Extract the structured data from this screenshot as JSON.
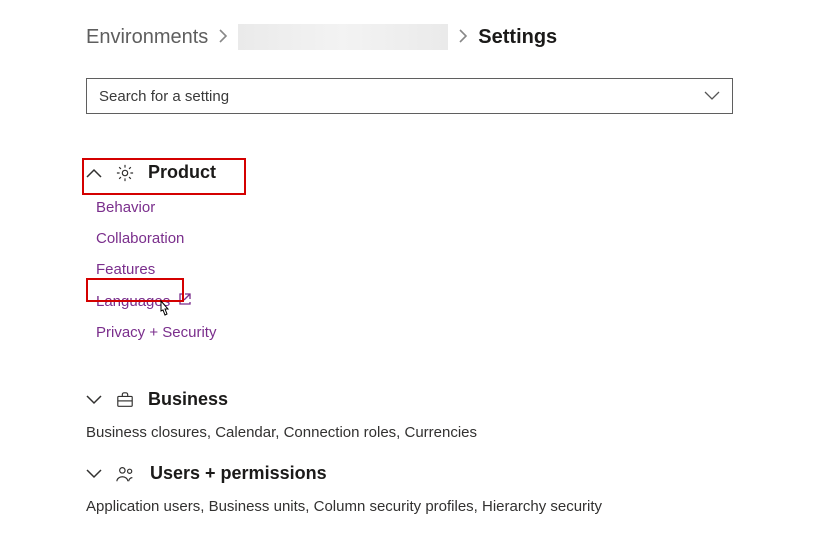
{
  "breadcrumb": {
    "root": "Environments",
    "current": "Settings"
  },
  "search": {
    "placeholder": "Search for a setting"
  },
  "sections": {
    "product": {
      "title": "Product",
      "links": {
        "behavior": "Behavior",
        "collaboration": "Collaboration",
        "features": "Features",
        "languages": "Languages",
        "privacy": "Privacy + Security"
      }
    },
    "business": {
      "title": "Business",
      "desc": "Business closures, Calendar, Connection roles, Currencies"
    },
    "users": {
      "title": "Users + permissions",
      "desc": "Application users, Business units, Column security profiles, Hierarchy security"
    }
  }
}
